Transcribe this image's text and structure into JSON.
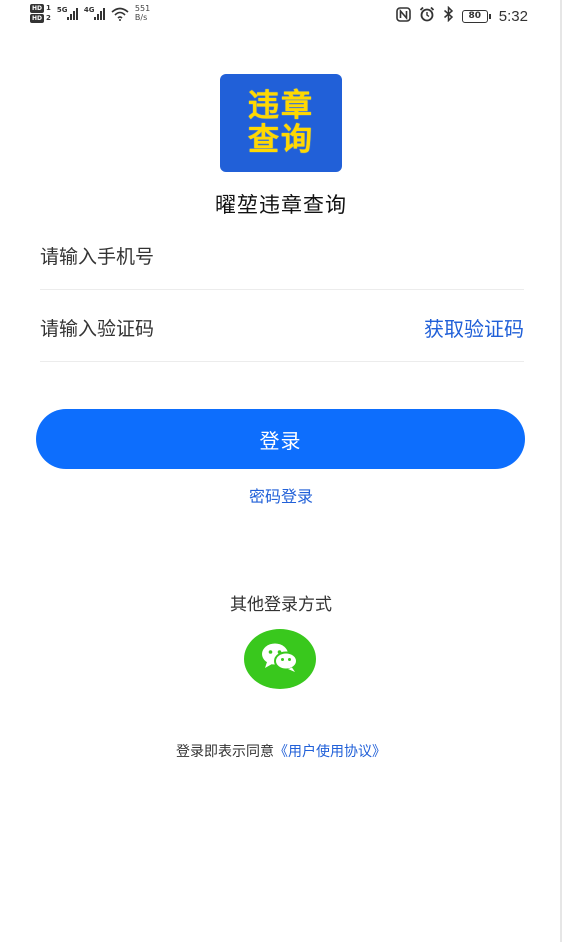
{
  "status_bar": {
    "hd1": "HD",
    "hd1_num": "1",
    "hd2": "HD",
    "hd2_num": "2",
    "sig1_tag": "5G",
    "sig2_tag": "4G",
    "net_speed_value": "551",
    "net_speed_unit": "B/s",
    "battery": "80",
    "time": "5:32",
    "icons": [
      "nfc-icon",
      "alarm-icon",
      "bluetooth-icon"
    ]
  },
  "app": {
    "logo_line1": "违章",
    "logo_line2": "查询",
    "logo_bg": "#2160d8",
    "logo_fg": "#ffd800",
    "name": "曜堃违章查询"
  },
  "form": {
    "phone_placeholder": "请输入手机号",
    "code_placeholder": "请输入验证码",
    "get_code": "获取验证码"
  },
  "buttons": {
    "login": "登录",
    "password_login": "密码登录"
  },
  "other": {
    "title": "其他登录方式",
    "wechat_icon": "wechat-icon"
  },
  "agreement": {
    "prefix": "登录即表示同意",
    "link": "《用户使用协议》"
  },
  "colors": {
    "primary": "#0d6efd",
    "link": "#2160d8",
    "wechat": "#39c81d"
  }
}
